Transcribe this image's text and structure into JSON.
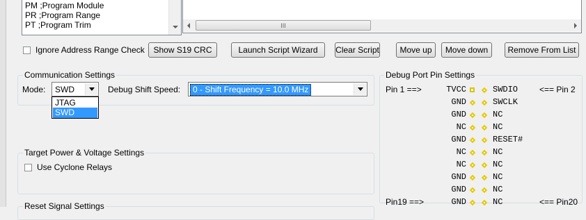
{
  "module_list": {
    "items": [
      {
        "code": "PM",
        "desc": ";Program Module"
      },
      {
        "code": "PR",
        "desc": ";Program Range"
      },
      {
        "code": "PT",
        "desc": ";Program Trim"
      }
    ]
  },
  "script_panel": {
    "hscroll_thumb": "III"
  },
  "options": {
    "ignore_address_range": "Ignore Address Range Check"
  },
  "toolbar": {
    "show_crc": "Show S19 CRC",
    "launch_wizard": "Launch Script  Wizard",
    "clear_script": "Clear Script",
    "move_up": "Move up",
    "move_down": "Move down",
    "remove": "Remove From List"
  },
  "comm": {
    "legend": "Communication Settings",
    "mode_label": "Mode:",
    "mode_value": "SWD",
    "mode_options": [
      "JTAG",
      "SWD"
    ],
    "shift_label": "Debug Shift Speed:",
    "shift_value": "0 - Shift Frequency  = 10.0 MHz"
  },
  "power": {
    "legend": "Target Power & Voltage Settings",
    "relays_label": "Use Cyclone Relays"
  },
  "reset": {
    "legend": "Reset Signal Settings"
  },
  "pins": {
    "legend": "Debug Port Pin Settings",
    "first_label": "Pin 1 ==>",
    "last_label": "Pin19 ==>",
    "rows": [
      {
        "left": "TVCC",
        "right": "SWDIO",
        "tail": "<== Pin 2"
      },
      {
        "left": "GND",
        "right": "SWCLK",
        "tail": ""
      },
      {
        "left": "GND",
        "right": "NC",
        "tail": ""
      },
      {
        "left": "NC",
        "right": "NC",
        "tail": ""
      },
      {
        "left": "GND",
        "right": "RESET#",
        "tail": ""
      },
      {
        "left": "NC",
        "right": "NC",
        "tail": ""
      },
      {
        "left": "NC",
        "right": "NC",
        "tail": ""
      },
      {
        "left": "GND",
        "right": "NC",
        "tail": ""
      },
      {
        "left": "GND",
        "right": "NC",
        "tail": ""
      },
      {
        "left": "GND",
        "right": "NC",
        "tail": "<== Pin20"
      }
    ]
  },
  "colors": {
    "selection": "#3399ff",
    "pin_marker": "#e5c800"
  }
}
